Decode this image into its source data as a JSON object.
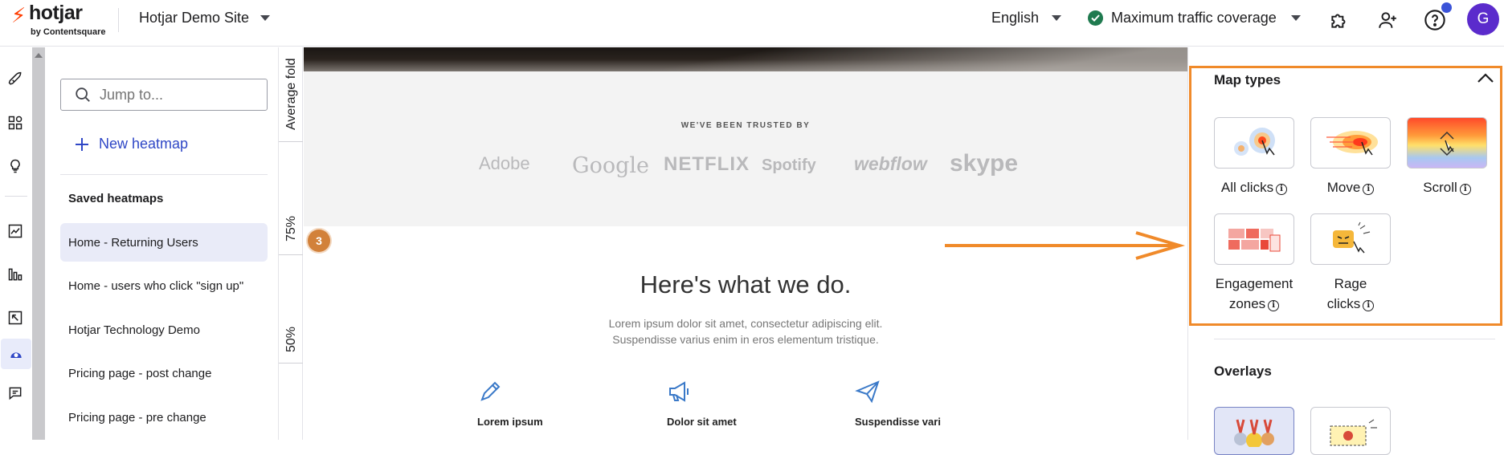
{
  "topbar": {
    "logo_word": "hotjar",
    "logo_sub": "by Contentsquare",
    "site_name": "Hotjar Demo Site",
    "language": "English",
    "traffic_label": "Maximum traffic coverage",
    "avatar_initial": "G",
    "icons": [
      "puzzle-icon",
      "add-user-icon",
      "help-icon"
    ]
  },
  "rail": {
    "icons": [
      "rocket-icon",
      "dashboard-icon",
      "lightbulb-icon",
      "trends-icon",
      "funnels-icon",
      "recordings-icon",
      "heatmaps-icon",
      "feedback-icon"
    ],
    "active": "heatmaps-icon"
  },
  "left_panel": {
    "search_placeholder": "Jump to...",
    "new_heatmap_label": "New heatmap",
    "saved_title": "Saved heatmaps",
    "saved_items": [
      {
        "label": "Home - Returning Users",
        "active": true
      },
      {
        "label": "Home - users who click \"sign up\"",
        "active": false
      },
      {
        "label": "Hotjar Technology Demo",
        "active": false
      },
      {
        "label": "Pricing page - post change",
        "active": false
      },
      {
        "label": "Pricing page - pre change",
        "active": false
      }
    ]
  },
  "fold": {
    "average_fold": "Average fold",
    "p75": "75%",
    "p50": "50%"
  },
  "preview": {
    "trusted_title": "WE'VE BEEN TRUSTED BY",
    "brands": [
      "Adobe",
      "Google",
      "NETFLIX",
      "Spotify",
      "webflow",
      "skype"
    ],
    "scroll_badge": "3",
    "section_title": "Here's what we do.",
    "section_text_line1": "Lorem ipsum dolor sit amet, consectetur adipiscing elit.",
    "section_text_line2": "Suspendisse varius enim in eros elementum tristique.",
    "features": [
      {
        "label": "Lorem ipsum",
        "icon": "pencil-icon"
      },
      {
        "label": "Dolor sit amet",
        "icon": "megaphone-icon"
      },
      {
        "label": "Suspendisse vari",
        "icon": "paper-plane-icon"
      }
    ]
  },
  "right_panel": {
    "map_types_title": "Map types",
    "map_types": [
      {
        "label": "All clicks",
        "icon": "clicks-map-icon"
      },
      {
        "label": "Move",
        "icon": "move-map-icon"
      },
      {
        "label": "Scroll",
        "icon": "scroll-map-icon"
      },
      {
        "label_line1": "Engagement",
        "label_line2": "zones",
        "icon": "engagement-zones-icon"
      },
      {
        "label_line1": "Rage",
        "label_line2": "clicks",
        "icon": "rage-clicks-icon"
      }
    ],
    "overlays_title": "Overlays",
    "overlays": [
      "top-elements-icon",
      "bug-overlay-icon"
    ]
  },
  "colors": {
    "accent": "#2f47c6",
    "highlight": "#f08a2a",
    "avatar": "#5b2bcc",
    "logo": "#ff3c00",
    "success": "#1f7a4f"
  }
}
